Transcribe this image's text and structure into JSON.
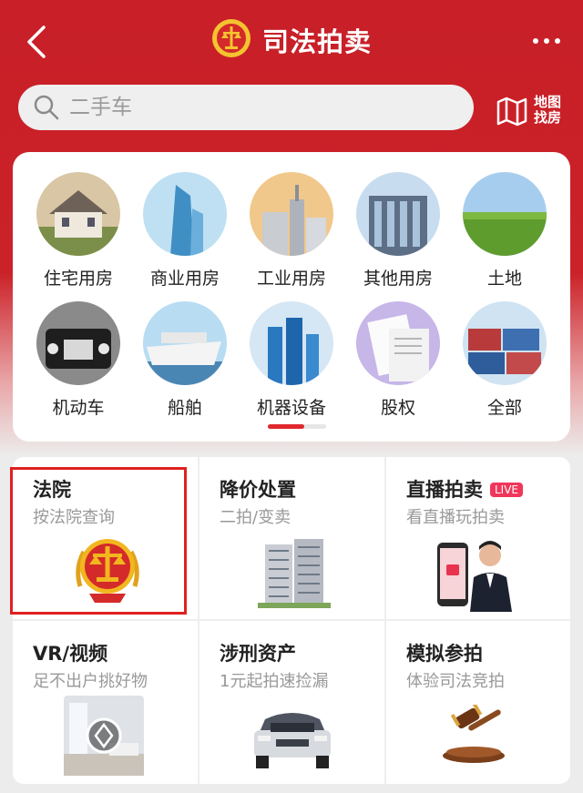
{
  "header": {
    "title": "司法拍卖"
  },
  "search": {
    "placeholder": "二手车"
  },
  "map_link": {
    "line1": "地图",
    "line2": "找房"
  },
  "categories": [
    {
      "label": "住宅用房"
    },
    {
      "label": "商业用房"
    },
    {
      "label": "工业用房"
    },
    {
      "label": "其他用房"
    },
    {
      "label": "土地"
    },
    {
      "label": "机动车"
    },
    {
      "label": "船舶"
    },
    {
      "label": "机器设备"
    },
    {
      "label": "股权"
    },
    {
      "label": "全部"
    }
  ],
  "features": [
    {
      "title": "法院",
      "subtitle": "按法院查询"
    },
    {
      "title": "降价处置",
      "subtitle": "二拍/变卖"
    },
    {
      "title": "直播拍卖",
      "subtitle": "看直播玩拍卖",
      "badge": "LIVE"
    },
    {
      "title": "VR/视频",
      "subtitle": "足不出户挑好物"
    },
    {
      "title": "涉刑资产",
      "subtitle": "1元起拍速捡漏"
    },
    {
      "title": "模拟参拍",
      "subtitle": "体验司法竞拍"
    }
  ],
  "icons": [
    "back-icon",
    "court-emblem-icon",
    "more-icon",
    "search-icon",
    "map-icon",
    "vr-play-icon"
  ],
  "colors": {
    "brand_red": "#cb2229",
    "accent": "#e0282e",
    "live_badge": "#f0365a"
  }
}
